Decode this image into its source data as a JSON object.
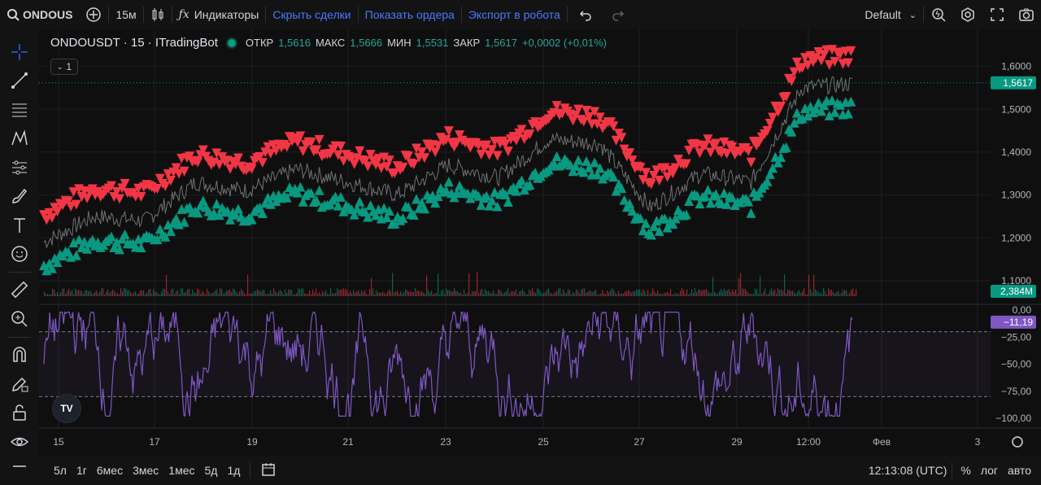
{
  "topbar": {
    "symbol": "ONDOUS",
    "interval": "15м",
    "indicators": "Индикаторы",
    "hide_trades": "Скрыть сделки",
    "show_orders": "Показать ордера",
    "export": "Экспорт в робота",
    "layout": "Default"
  },
  "legend": {
    "title": "ONDOUSDT · 15 · ITradingBot",
    "open_label": "ОТКР",
    "open": "1,5616",
    "high_label": "МАКС",
    "high": "1,5666",
    "low_label": "МИН",
    "low": "1,5531",
    "close_label": "ЗАКР",
    "close": "1,5617",
    "change": "+0,0002 (+0,01%)",
    "collapse_count": "1"
  },
  "price_axis": [
    "1,6000",
    "1,5000",
    "1,4000",
    "1,3000",
    "1,2000",
    "1,1000"
  ],
  "osc_axis": [
    "0,00",
    "−25,00",
    "−50,00",
    "−75,00",
    "−100,00"
  ],
  "last_price": "1,5617",
  "volume_tag": "2,384M",
  "osc_tag": "−11,19",
  "time_axis": [
    "15",
    "17",
    "19",
    "21",
    "23",
    "25",
    "27",
    "29",
    "12:00",
    "Фев",
    "3"
  ],
  "bottombar": {
    "ranges": [
      "5л",
      "1г",
      "6мес",
      "3мес",
      "1мес",
      "5д",
      "1д"
    ],
    "clock": "12:13:08 (UTC)",
    "percent": "%",
    "log": "лог",
    "auto": "авто"
  },
  "logo_text": "TV",
  "colors": {
    "up": "#089981",
    "down": "#f23645",
    "osc": "#7e57c2",
    "accent": "#4b79ff"
  },
  "chart_data": {
    "type": "line",
    "price_series": {
      "x": [
        "15",
        "16",
        "17",
        "18",
        "19",
        "20",
        "21",
        "22",
        "23",
        "24",
        "25",
        "26",
        "27",
        "28",
        "29",
        "30-12:00",
        "Фев"
      ],
      "mid": [
        1.19,
        1.25,
        1.24,
        1.33,
        1.31,
        1.36,
        1.33,
        1.3,
        1.37,
        1.34,
        1.43,
        1.42,
        1.27,
        1.35,
        1.33,
        1.55,
        1.56
      ]
    },
    "y_range": [
      1.06,
      1.66
    ],
    "oscillator": {
      "range": [
        -100,
        0
      ],
      "upper_band": -20,
      "lower_band": -80
    }
  }
}
